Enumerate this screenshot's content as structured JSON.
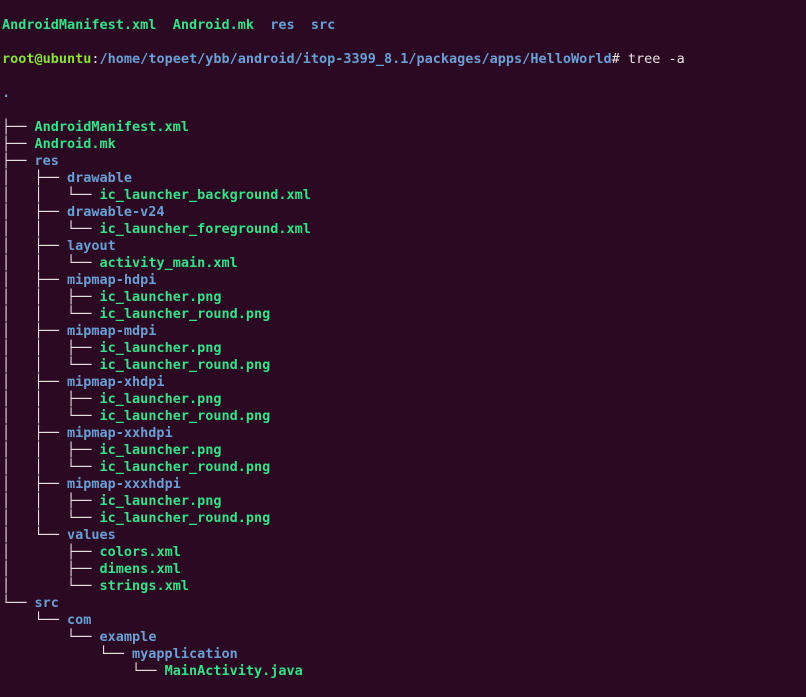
{
  "top_ls": {
    "items": [
      "AndroidManifest.xml",
      "Android.mk",
      "res",
      "src"
    ]
  },
  "prompt": {
    "user_host": "root@ubuntu",
    "path": "/home/topeet/ybb/android/itop-3399_8.1/packages/apps/HelloWorld",
    "symbol": "#",
    "command": "tree -a"
  },
  "tree": {
    "root": ".",
    "nodes": [
      {
        "indent": 0,
        "branch": "├── ",
        "name": "AndroidManifest.xml",
        "type": "file"
      },
      {
        "indent": 0,
        "branch": "├── ",
        "name": "Android.mk",
        "type": "file"
      },
      {
        "indent": 0,
        "branch": "├── ",
        "name": "res",
        "type": "dir"
      },
      {
        "indent": 1,
        "prefix": "│   ",
        "branch": "├── ",
        "name": "drawable",
        "type": "dir"
      },
      {
        "indent": 2,
        "prefix": "│   │   ",
        "branch": "└── ",
        "name": "ic_launcher_background.xml",
        "type": "file"
      },
      {
        "indent": 1,
        "prefix": "│   ",
        "branch": "├── ",
        "name": "drawable-v24",
        "type": "dir"
      },
      {
        "indent": 2,
        "prefix": "│   │   ",
        "branch": "└── ",
        "name": "ic_launcher_foreground.xml",
        "type": "file"
      },
      {
        "indent": 1,
        "prefix": "│   ",
        "branch": "├── ",
        "name": "layout",
        "type": "dir"
      },
      {
        "indent": 2,
        "prefix": "│   │   ",
        "branch": "└── ",
        "name": "activity_main.xml",
        "type": "file"
      },
      {
        "indent": 1,
        "prefix": "│   ",
        "branch": "├── ",
        "name": "mipmap-hdpi",
        "type": "dir"
      },
      {
        "indent": 2,
        "prefix": "│   │   ",
        "branch": "├── ",
        "name": "ic_launcher.png",
        "type": "file"
      },
      {
        "indent": 2,
        "prefix": "│   │   ",
        "branch": "└── ",
        "name": "ic_launcher_round.png",
        "type": "file"
      },
      {
        "indent": 1,
        "prefix": "│   ",
        "branch": "├── ",
        "name": "mipmap-mdpi",
        "type": "dir"
      },
      {
        "indent": 2,
        "prefix": "│   │   ",
        "branch": "├── ",
        "name": "ic_launcher.png",
        "type": "file"
      },
      {
        "indent": 2,
        "prefix": "│   │   ",
        "branch": "└── ",
        "name": "ic_launcher_round.png",
        "type": "file"
      },
      {
        "indent": 1,
        "prefix": "│   ",
        "branch": "├── ",
        "name": "mipmap-xhdpi",
        "type": "dir"
      },
      {
        "indent": 2,
        "prefix": "│   │   ",
        "branch": "├── ",
        "name": "ic_launcher.png",
        "type": "file"
      },
      {
        "indent": 2,
        "prefix": "│   │   ",
        "branch": "└── ",
        "name": "ic_launcher_round.png",
        "type": "file"
      },
      {
        "indent": 1,
        "prefix": "│   ",
        "branch": "├── ",
        "name": "mipmap-xxhdpi",
        "type": "dir"
      },
      {
        "indent": 2,
        "prefix": "│   │   ",
        "branch": "├── ",
        "name": "ic_launcher.png",
        "type": "file"
      },
      {
        "indent": 2,
        "prefix": "│   │   ",
        "branch": "└── ",
        "name": "ic_launcher_round.png",
        "type": "file"
      },
      {
        "indent": 1,
        "prefix": "│   ",
        "branch": "├── ",
        "name": "mipmap-xxxhdpi",
        "type": "dir"
      },
      {
        "indent": 2,
        "prefix": "│   │   ",
        "branch": "├── ",
        "name": "ic_launcher.png",
        "type": "file"
      },
      {
        "indent": 2,
        "prefix": "│   │   ",
        "branch": "└── ",
        "name": "ic_launcher_round.png",
        "type": "file"
      },
      {
        "indent": 1,
        "prefix": "│   ",
        "branch": "└── ",
        "name": "values",
        "type": "dir"
      },
      {
        "indent": 2,
        "prefix": "│       ",
        "branch": "├── ",
        "name": "colors.xml",
        "type": "file"
      },
      {
        "indent": 2,
        "prefix": "│       ",
        "branch": "├── ",
        "name": "dimens.xml",
        "type": "file"
      },
      {
        "indent": 2,
        "prefix": "│       ",
        "branch": "└── ",
        "name": "strings.xml",
        "type": "file"
      },
      {
        "indent": 0,
        "branch": "└── ",
        "name": "src",
        "type": "dir"
      },
      {
        "indent": 1,
        "prefix": "    ",
        "branch": "└── ",
        "name": "com",
        "type": "dir"
      },
      {
        "indent": 2,
        "prefix": "        ",
        "branch": "└── ",
        "name": "example",
        "type": "dir"
      },
      {
        "indent": 3,
        "prefix": "            ",
        "branch": "└── ",
        "name": "myapplication",
        "type": "dir"
      },
      {
        "indent": 4,
        "prefix": "                ",
        "branch": "└── ",
        "name": "MainActivity.java",
        "type": "file"
      }
    ]
  }
}
